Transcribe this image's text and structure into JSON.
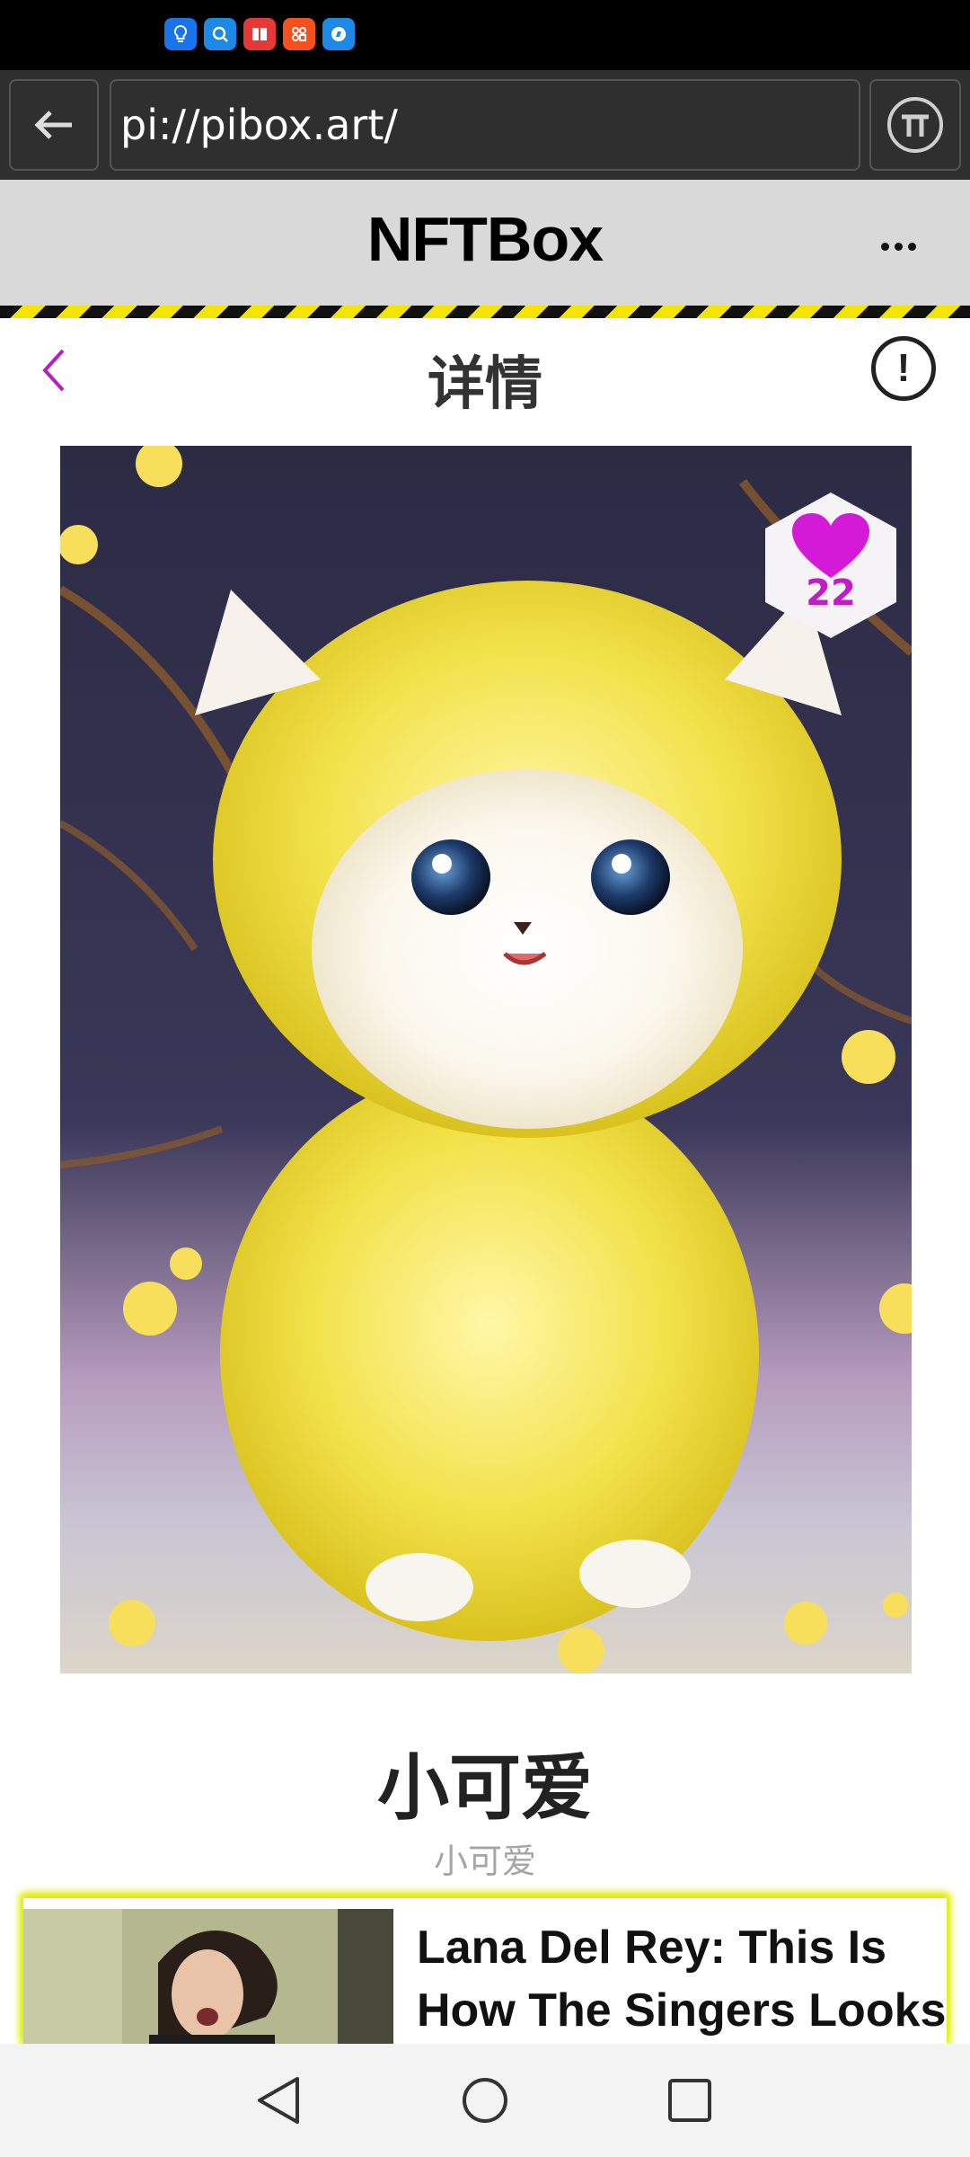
{
  "status_bar": {
    "icons": [
      "lightbulb-icon",
      "search-icon",
      "book-icon",
      "apps-icon",
      "compass-icon"
    ],
    "icon_colors": [
      "#1a73e8",
      "#1e88e5",
      "#e53935",
      "#f4511e",
      "#1e88e5"
    ]
  },
  "browser": {
    "url": "pi://pibox.art/",
    "back_icon": "arrow-left-icon",
    "pi_icon": "pi-logo-icon"
  },
  "app": {
    "title": "NFTBox",
    "more_icon": "more-dots-icon"
  },
  "detail": {
    "title": "详情",
    "back_icon": "chevron-left-icon",
    "info_icon": "exclamation-icon",
    "accent_color": "#b620c0"
  },
  "nft": {
    "image_icon": "yellow-fluffy-puppy-image",
    "likes": "22",
    "like_color": "#d41ad6",
    "name": "小可爱",
    "description": "小可爱"
  },
  "ad": {
    "headline": "Lana Del Rey: This Is How The Singers Looks"
  },
  "nav": {
    "back_icon": "triangle-back-icon",
    "home_icon": "circle-home-icon",
    "recents_icon": "square-recents-icon"
  }
}
